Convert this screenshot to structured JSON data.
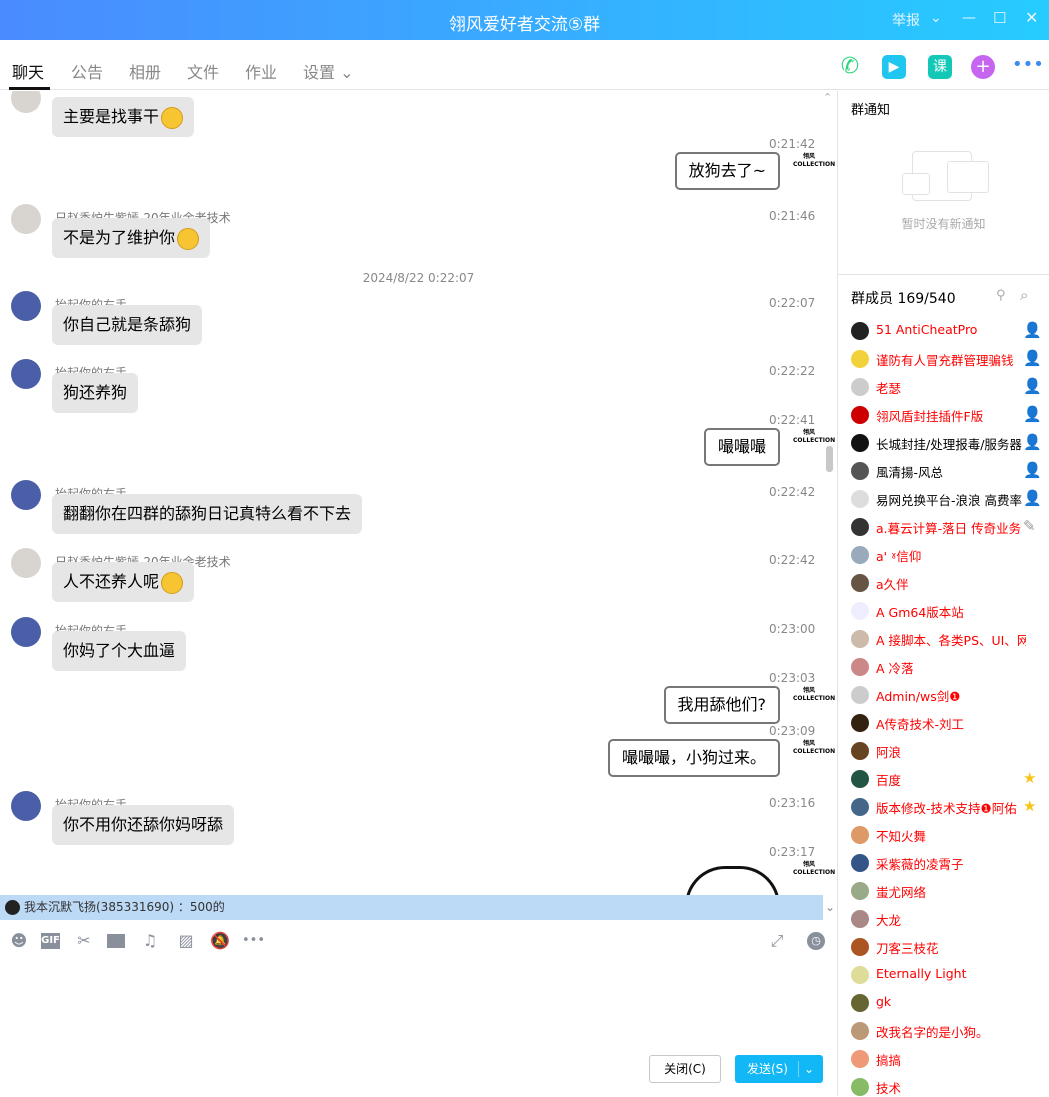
{
  "window": {
    "title": "翎风爱好者交流⑤群",
    "report": "举报",
    "controls": [
      "chevron-down",
      "minimize",
      "maximize",
      "close"
    ]
  },
  "tabs": [
    {
      "label": "聊天",
      "active": true
    },
    {
      "label": "公告"
    },
    {
      "label": "相册"
    },
    {
      "label": "文件"
    },
    {
      "label": "作业"
    },
    {
      "label": "设置 ⌄"
    }
  ],
  "header_tools": [
    {
      "icon": "phone-icon",
      "color": "#2bd47a"
    },
    {
      "icon": "video-icon",
      "color": "#1fc6f0"
    },
    {
      "icon": "course-icon",
      "label": "课",
      "color": "#14c8b8"
    },
    {
      "icon": "plus-bubble-icon",
      "color": "#c565f0"
    },
    {
      "icon": "more-icon",
      "color": "#3a8cf0"
    }
  ],
  "chat": {
    "date_separator": "2024/8/22 0:22:07",
    "messages": [
      {
        "mine": false,
        "sender": "",
        "time": "",
        "text": "主要是找事干",
        "emoji": true
      },
      {
        "mine": true,
        "time": "0:21:42",
        "text": "放狗去了~"
      },
      {
        "mine": false,
        "sender": "日赵香炉生紫嫣-20年业余老技术",
        "time": "0:21:46",
        "text": "不是为了维护你",
        "emoji": true
      },
      {
        "mine": false,
        "sender": "抬起你的右手",
        "time": "0:22:07",
        "text": "你自己就是条舔狗"
      },
      {
        "mine": false,
        "sender": "抬起你的右手",
        "time": "0:22:22",
        "text": "狗还养狗"
      },
      {
        "mine": true,
        "time": "0:22:41",
        "text": "嘬嘬嘬"
      },
      {
        "mine": false,
        "sender": "抬起你的右手",
        "time": "0:22:42",
        "text": "翻翻你在四群的舔狗日记真特么看不下去"
      },
      {
        "mine": false,
        "sender": "日赵香炉生紫嫣-20年业余老技术",
        "time": "0:22:42",
        "text": "人不还养人呢",
        "emoji": true
      },
      {
        "mine": false,
        "sender": "抬起你的右手",
        "time": "0:23:00",
        "text": "你妈了个大血逼"
      },
      {
        "mine": true,
        "time": "0:23:03",
        "text": "我用舔他们?"
      },
      {
        "mine": true,
        "time": "0:23:09",
        "text": "嘬嘬嘬，小狗过来。"
      },
      {
        "mine": false,
        "sender": "抬起你的右手",
        "time": "0:23:16",
        "text": "你不用你还舔你妈呀舔"
      },
      {
        "mine": true,
        "time": "0:23:17",
        "text": "",
        "image": "panda-sticker"
      }
    ],
    "my_avatar_text": "翎风 COLLECTION"
  },
  "new_message_notice": "我本沉默飞扬(385331690) ：500的",
  "input_toolbar": [
    "emoji-icon",
    "gif-icon",
    "scissors-icon",
    "folder-icon",
    "music-icon",
    "image-icon",
    "mute-bell-icon",
    "more-icon"
  ],
  "input_toolbar_right": [
    "expand-icon",
    "history-clock-icon"
  ],
  "input": {
    "value": ""
  },
  "buttons": {
    "close": "关闭(C)",
    "send": "发送(S)"
  },
  "group_notice": {
    "title": "群通知",
    "empty": "暂时没有新通知"
  },
  "members": {
    "title": "群成员 169/540",
    "list": [
      {
        "name": "51 AntiCheatPro",
        "color": "#f00",
        "badge": "owner"
      },
      {
        "name": "谨防有人冒充群管理骗钱",
        "color": "#f00",
        "badge": "admin"
      },
      {
        "name": "老瑟",
        "color": "#f00",
        "badge": "admin"
      },
      {
        "name": "翎风盾封挂插件F版",
        "color": "#f00",
        "badge": "admin"
      },
      {
        "name": "长城封挂/处理报毒/服务器",
        "color": "#000",
        "badge": "admin"
      },
      {
        "name": "風清揚-风总",
        "color": "#000",
        "badge": "admin"
      },
      {
        "name": "易网兑换平台-浪浪  高费率",
        "color": "#000",
        "badge": "admin"
      },
      {
        "name": "a.暮云计算-落日 传奇业务",
        "color": "#f00",
        "badge": "edit"
      },
      {
        "name": "a' ˠ信仰",
        "color": "#f00"
      },
      {
        "name": "a久伴",
        "color": "#f00"
      },
      {
        "name": "A     Gm64版本站",
        "color": "#f00"
      },
      {
        "name": "A 接脚本、各类PS、UI、网页",
        "color": "#f00"
      },
      {
        "name": "A 冷落",
        "color": "#f00"
      },
      {
        "name": "Admin/ws剑❶",
        "color": "#f00"
      },
      {
        "name": "A传奇技术-刘工",
        "color": "#f00"
      },
      {
        "name": "阿浪",
        "color": "#f00"
      },
      {
        "name": "百度",
        "color": "#f00",
        "badge": "star"
      },
      {
        "name": "版本修改-技术支持❶阿佑",
        "color": "#f00",
        "badge": "star"
      },
      {
        "name": "不知火舞",
        "color": "#f00"
      },
      {
        "name": "采紫薇的凌霄子",
        "color": "#f00"
      },
      {
        "name": "蚩尤网络",
        "color": "#f00"
      },
      {
        "name": "大龙",
        "color": "#f00"
      },
      {
        "name": "刀客三枝花",
        "color": "#f00"
      },
      {
        "name": "Eternally Light",
        "color": "#f00"
      },
      {
        "name": "gk",
        "color": "#f00"
      },
      {
        "name": "改我名字的是小狗。",
        "color": "#f00"
      },
      {
        "name": "搞搞",
        "color": "#f00"
      },
      {
        "name": "技术",
        "color": "#f00"
      }
    ]
  }
}
